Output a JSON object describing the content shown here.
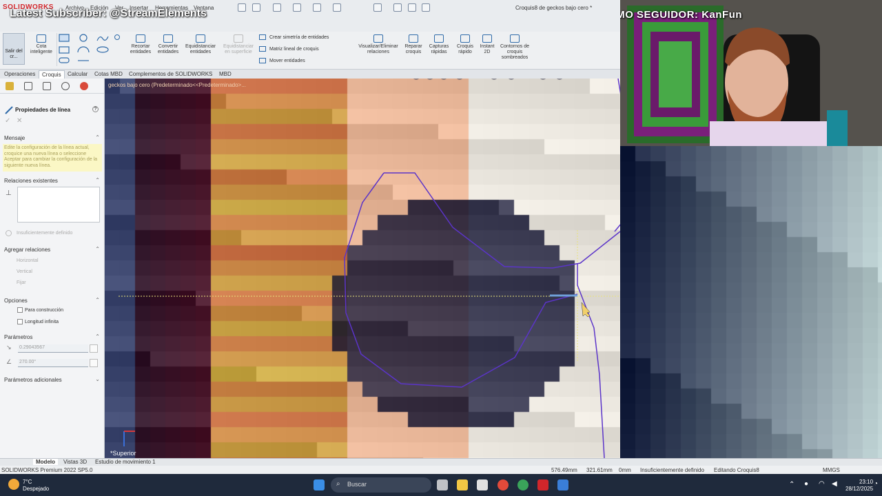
{
  "app": {
    "logo": "SOLIDWORKS",
    "document_title": "Croquis8 de geckos bajo cero *"
  },
  "menu": [
    "Archivo",
    "Edición",
    "Ver",
    "Insertar",
    "Herramientas",
    "Ventana"
  ],
  "overlay": {
    "latest_subscriber": "Latest Subscriber: @StreamElements",
    "last_follower": "ÚLTIMO SEGUIDOR: KanFun"
  },
  "commands": {
    "exit_sketch": "Salir del cr...",
    "smart_dimension": "Cota inteligente",
    "trim": "Recortar entidades",
    "convert": "Convertir entidades",
    "offset": "Equidistanciar entidades",
    "offset_surface": "Equidistanciar en superficie",
    "mirror": "Crear simetría de entidades",
    "linear_pattern": "Matriz lineal de croquis",
    "move": "Mover entidades",
    "relations": "Visualizar/Eliminar relaciones",
    "repair": "Reparar croquis",
    "quick_snaps": "Capturas rápidas",
    "rapid_sketch": "Croquis rápido",
    "instant2d": "Instant 2D",
    "shaded_contours": "Contornos de croquis sombreados"
  },
  "tabs": [
    "Operaciones",
    "Croquis",
    "Calcular",
    "Cotas MBD",
    "Complementos de SOLIDWORKS",
    "MBD"
  ],
  "active_tab": "Croquis",
  "property_manager": {
    "title": "Propiedades de línea",
    "message_header": "Mensaje",
    "message": "Edite la configuración de la línea actual, croquice una nueva línea o seleccione Aceptar para cambiar la configuración de la siguiente nueva línea.",
    "existing_relations": "Relaciones existentes",
    "under_defined": "Insuficientemente definido",
    "add_relations": "Agregar relaciones",
    "relations": [
      "Horizontal",
      "Vertical",
      "Fijar"
    ],
    "options": "Opciones",
    "construction": "Para construcción",
    "infinite_length": "Longitud infinita",
    "parameters": "Parámetros",
    "length_value": "0.29043567",
    "angle_value": "270.00°",
    "additional_parameters": "Parámetros adicionales"
  },
  "graphics": {
    "tree_node": "geckos bajo cero (Predeterminado<<Predeterminado>...",
    "view_label": "*Superior",
    "palette": {
      "dark": "#1c1d3a",
      "orange": "#c86a3a",
      "peach": "#e8b08a",
      "pale": "#e9e3d8",
      "sketch": "#5b34c9",
      "guide": "#e8e37a"
    }
  },
  "model_tabs": [
    "Modelo",
    "Vistas 3D",
    "Estudio de movimiento 1"
  ],
  "status": {
    "product": "SOLIDWORKS Premium 2022 SP5.0",
    "x": "576.49mm",
    "y": "321.61mm",
    "z": "0mm",
    "definition": "Insuficientemente definido",
    "editing": "Editando Croquis8",
    "units": "MMGS"
  },
  "taskbar": {
    "weather_temp": "7°C",
    "weather_desc": "Despejado",
    "search_placeholder": "Buscar",
    "time": "23:10",
    "date": "28/12/2025"
  }
}
